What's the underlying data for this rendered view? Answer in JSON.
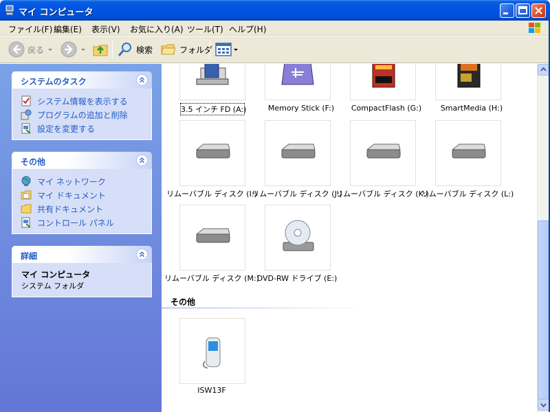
{
  "window": {
    "title": "マイ コンピュータ"
  },
  "menu": [
    "ファイル(F)",
    "編集(E)",
    "表示(V)",
    "お気に入り(A)",
    "ツール(T)",
    "ヘルプ(H)"
  ],
  "toolbar": {
    "back": "戻る",
    "search": "検索",
    "folders": "フォルダ"
  },
  "taskpane": {
    "system_tasks": {
      "title": "システムのタスク",
      "items": [
        "システム情報を表示する",
        "プログラムの追加と削除",
        "設定を変更する"
      ]
    },
    "other_places": {
      "title": "その他",
      "items": [
        "マイ ネットワーク",
        "マイ ドキュメント",
        "共有ドキュメント",
        "コントロール パネル"
      ]
    },
    "details": {
      "title": "詳細",
      "name": "マイ コンピュータ",
      "sub": "システム フォルダ"
    }
  },
  "drives": [
    "3.5 インチ FD (A:)",
    "Memory Stick (F:)",
    "CompactFlash (G:)",
    "SmartMedia (H:)",
    "リムーバブル ディスク (I:)",
    "リムーバブル ディスク (J:)",
    "リムーバブル ディスク (K:)",
    "リムーバブル ディスク (L:)",
    "リムーバブル ディスク (M:)",
    "DVD-RW ドライブ (E:)"
  ],
  "other_group": {
    "title": "その他",
    "items": [
      "ISW13F"
    ]
  },
  "icons": {
    "floppy": "floppy-drive-icon",
    "memorystick": "memory-stick-icon",
    "compactflash": "compactflash-icon",
    "smartmedia": "smartmedia-icon",
    "removable": "removable-disk-icon",
    "dvd": "dvd-drive-icon",
    "phone": "phone-device-icon"
  }
}
